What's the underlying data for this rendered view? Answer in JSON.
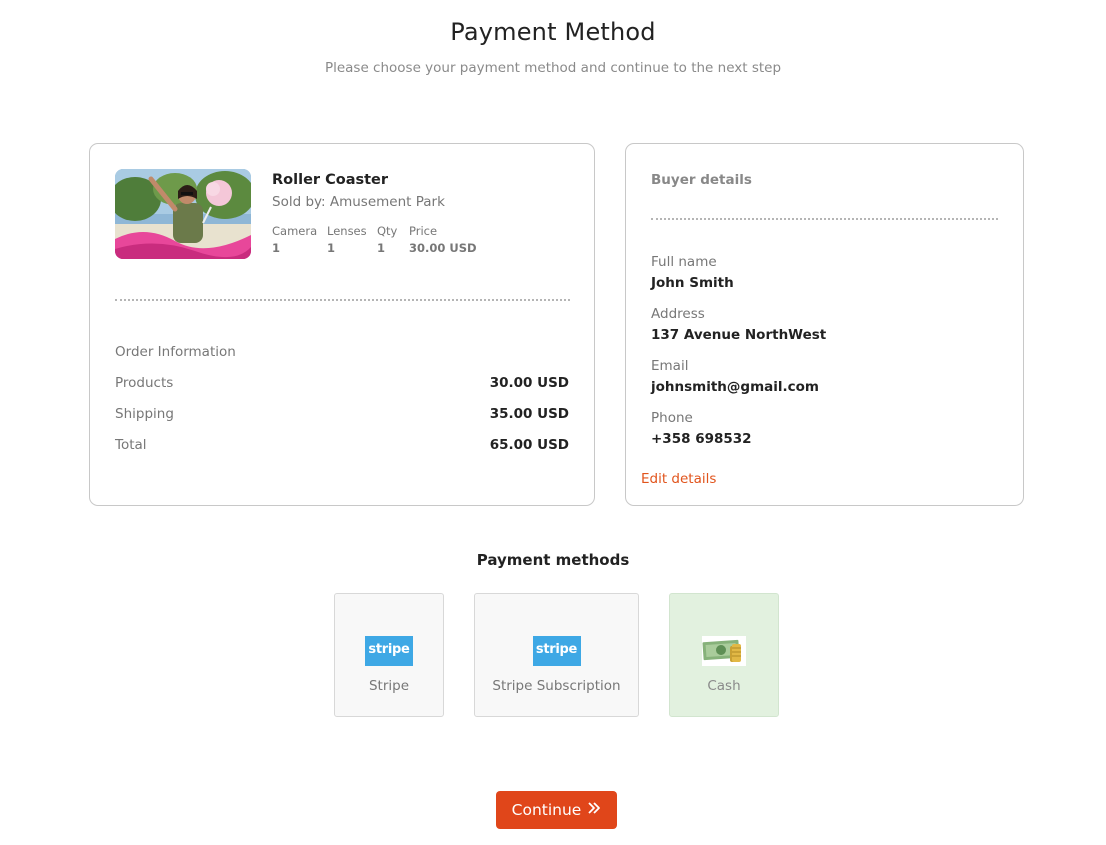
{
  "header": {
    "title": "Payment Method",
    "subtitle": "Please choose your payment method and continue to the next step"
  },
  "order": {
    "product": {
      "name": "Roller Coaster",
      "seller": "Sold by: Amusement Park",
      "image_icon": "product-photo-amusement-park",
      "specs": [
        {
          "label": "Camera",
          "value": "1"
        },
        {
          "label": "Lenses",
          "value": "1"
        },
        {
          "label": "Qty",
          "value": "1"
        },
        {
          "label": "Price",
          "value": "30.00 USD"
        }
      ]
    },
    "info_title": "Order Information",
    "rows": [
      {
        "label": "Products",
        "value": "30.00 USD"
      },
      {
        "label": "Shipping",
        "value": "35.00 USD"
      },
      {
        "label": "Total",
        "value": "65.00 USD"
      }
    ]
  },
  "buyer": {
    "heading": "Buyer details",
    "fields": [
      {
        "label": "Full name",
        "value": "John Smith"
      },
      {
        "label": "Address",
        "value": "137 Avenue NorthWest"
      },
      {
        "label": "Email",
        "value": "johnsmith@gmail.com"
      },
      {
        "label": "Phone",
        "value": "+358 698532"
      }
    ],
    "edit_label": "Edit details"
  },
  "payment": {
    "title": "Payment methods",
    "methods": [
      {
        "label": "Stripe",
        "logo_text": "stripe",
        "icon": "stripe-logo",
        "selected": false
      },
      {
        "label": "Stripe Subscription",
        "logo_text": "stripe",
        "icon": "stripe-logo",
        "selected": false
      },
      {
        "label": "Cash",
        "icon": "cash-icon",
        "selected": true
      }
    ]
  },
  "actions": {
    "continue_label": "Continue",
    "continue_icon": "double-chevron-right-icon"
  },
  "colors": {
    "accent": "#e0461a",
    "link": "#e1541c",
    "stripe": "#3ea8e5",
    "selected_method_bg": "#e2f1df"
  }
}
